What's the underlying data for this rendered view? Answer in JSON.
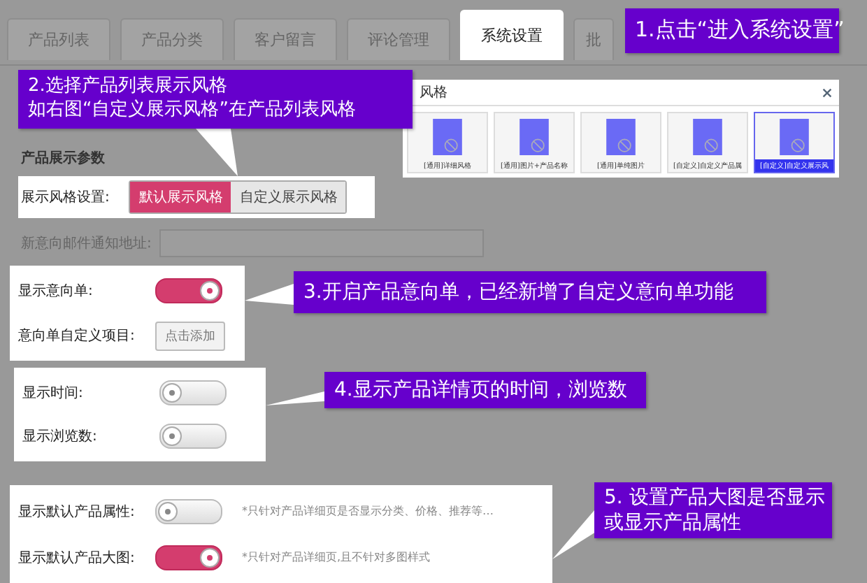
{
  "tabs": [
    {
      "label": "产品列表",
      "selected": false
    },
    {
      "label": "产品分类",
      "selected": false
    },
    {
      "label": "客户留言",
      "selected": false
    },
    {
      "label": "评论管理",
      "selected": false
    },
    {
      "label": "系统设置",
      "selected": true
    },
    {
      "label": "批",
      "selected": false
    }
  ],
  "dialog": {
    "title": "风格",
    "styles": [
      {
        "caption": "[通用]详细风格",
        "selected": false
      },
      {
        "caption": "[通用]图片+产品名称",
        "selected": false
      },
      {
        "caption": "[通用]单纯图片",
        "selected": false
      },
      {
        "caption": "[自定义]自定义产品属",
        "selected": false
      },
      {
        "caption": "[自定义]自定义展示风",
        "selected": true
      }
    ]
  },
  "section_title": "产品展示参数",
  "display_style": {
    "label": "展示风格设置:",
    "options": [
      {
        "label": "默认展示风格",
        "selected": true
      },
      {
        "label": "自定义展示风格",
        "selected": false
      }
    ]
  },
  "notify_email": {
    "label": "新意向邮件通知地址:"
  },
  "panels": [
    {
      "rows": [
        {
          "kind": "toggle",
          "label": "显示意向单:",
          "on": true
        },
        {
          "kind": "button",
          "label": "意向单自定义项目:",
          "button": "点击添加"
        }
      ]
    },
    {
      "rows": [
        {
          "kind": "toggle",
          "label": "显示时间:",
          "on": false
        },
        {
          "kind": "toggle",
          "label": "显示浏览数:",
          "on": false
        }
      ]
    },
    {
      "rows": [
        {
          "kind": "toggle",
          "label": "显示默认产品属性:",
          "on": false,
          "note": "*只针对产品详细页是否显示分类、价格、推荐等…"
        },
        {
          "kind": "toggle",
          "label": "显示默认产品大图:",
          "on": true,
          "note": "*只针对产品详细页,且不针对多图样式"
        }
      ]
    }
  ],
  "annotations": [
    {
      "lines": [
        "1.点击“进入系统设置”"
      ]
    },
    {
      "lines": [
        "2.选择产品列表展示风格",
        "如右图“自定义展示风格”在产品列表风格"
      ]
    },
    {
      "lines": [
        "3.开启产品意向单，已经新增了自定义意向单功能"
      ]
    },
    {
      "lines": [
        "4.显示产品详情页的时间，浏览数"
      ]
    },
    {
      "lines": [
        "5. 设置产品大图是否显示",
        "或显示产品属性"
      ]
    }
  ]
}
